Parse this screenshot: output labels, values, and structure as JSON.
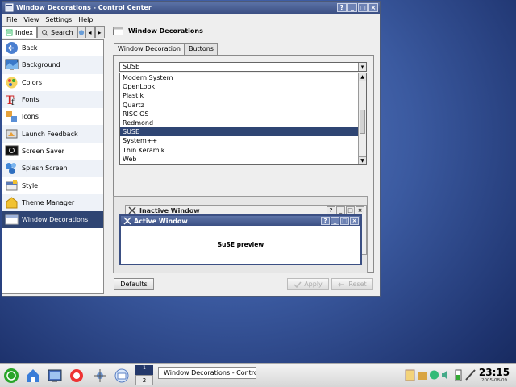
{
  "window": {
    "title": "Window Decorations - Control Center",
    "buttons": [
      "?",
      "_",
      "□",
      "×"
    ]
  },
  "menubar": [
    "File",
    "View",
    "Settings",
    "Help"
  ],
  "nav": {
    "tabs": {
      "index": "Index",
      "search": "Search"
    },
    "items": [
      {
        "label": "Back",
        "icon": "back-arrow-icon"
      },
      {
        "label": "Background",
        "icon": "background-icon"
      },
      {
        "label": "Colors",
        "icon": "colors-icon"
      },
      {
        "label": "Fonts",
        "icon": "fonts-icon"
      },
      {
        "label": "Icons",
        "icon": "icons-icon"
      },
      {
        "label": "Launch Feedback",
        "icon": "launch-feedback-icon"
      },
      {
        "label": "Screen Saver",
        "icon": "screen-saver-icon"
      },
      {
        "label": "Splash Screen",
        "icon": "splash-screen-icon"
      },
      {
        "label": "Style",
        "icon": "style-icon"
      },
      {
        "label": "Theme Manager",
        "icon": "theme-manager-icon"
      },
      {
        "label": "Window Decorations",
        "icon": "window-decorations-icon",
        "selected": true
      }
    ]
  },
  "panel": {
    "heading": "Window Decorations",
    "tabs": [
      "Window Decoration",
      "Buttons"
    ],
    "combo_value": "SUSE",
    "list": [
      "Modern System",
      "OpenLook",
      "Plastik",
      "Quartz",
      "RISC OS",
      "Redmond",
      "SUSE",
      "System++",
      "Thin Keramik",
      "Web"
    ],
    "selected": "SUSE",
    "preview": {
      "inactive_title": "Inactive Window",
      "active_title": "Active Window",
      "text": "SuSE preview"
    },
    "buttons": {
      "defaults": "Defaults",
      "apply": "Apply",
      "reset": "Reset"
    }
  },
  "taskbar": {
    "pager": [
      "1",
      "2"
    ],
    "task_label": "Window Decorations - Contro",
    "clock_time": "23:15",
    "clock_date": "2005-08-09"
  },
  "colors": {
    "accent": "#2f4573",
    "titlebar": "#3b4f83",
    "desktop": "#3b5aa0"
  }
}
